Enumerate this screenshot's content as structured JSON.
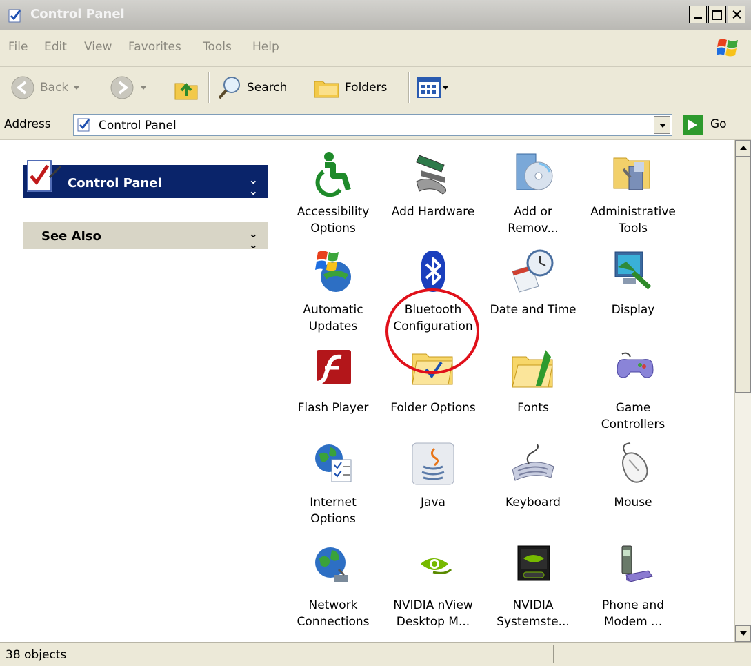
{
  "window": {
    "title": "Control Panel"
  },
  "menu": {
    "items": [
      "File",
      "Edit",
      "View",
      "Favorites",
      "Tools",
      "Help"
    ]
  },
  "toolbar": {
    "back_label": "Back",
    "search_label": "Search",
    "folders_label": "Folders"
  },
  "address": {
    "label": "Address",
    "value": "Control Panel",
    "go_label": "Go"
  },
  "taskpane": {
    "control_panel_label": "Control Panel",
    "see_also_label": "See Also"
  },
  "items": [
    {
      "label": "Accessibility\nOptions",
      "icon": "accessibility-icon"
    },
    {
      "label": "Add Hardware",
      "icon": "add-hardware-icon"
    },
    {
      "label": "Add or\nRemov...",
      "icon": "add-remove-programs-icon"
    },
    {
      "label": "Administrative\nTools",
      "icon": "administrative-tools-icon"
    },
    {
      "label": "Automatic\nUpdates",
      "icon": "automatic-updates-icon"
    },
    {
      "label": "Bluetooth\nConfiguration",
      "icon": "bluetooth-icon"
    },
    {
      "label": "Date and Time",
      "icon": "date-time-icon"
    },
    {
      "label": "Display",
      "icon": "display-icon"
    },
    {
      "label": "Flash Player",
      "icon": "flash-player-icon"
    },
    {
      "label": "Folder Options",
      "icon": "folder-options-icon"
    },
    {
      "label": "Fonts",
      "icon": "fonts-icon"
    },
    {
      "label": "Game\nControllers",
      "icon": "game-controller-icon"
    },
    {
      "label": "Internet\nOptions",
      "icon": "internet-options-icon"
    },
    {
      "label": "Java",
      "icon": "java-icon"
    },
    {
      "label": "Keyboard",
      "icon": "keyboard-icon"
    },
    {
      "label": "Mouse",
      "icon": "mouse-icon"
    },
    {
      "label": "Network\nConnections",
      "icon": "network-connections-icon"
    },
    {
      "label": "NVIDIA nView\nDesktop M...",
      "icon": "nvidia-nview-icon"
    },
    {
      "label": "NVIDIA\nSystemste...",
      "icon": "nvidia-systemsteuerung-icon"
    },
    {
      "label": "Phone and\nModem ...",
      "icon": "phone-modem-icon"
    }
  ],
  "status": {
    "text": "38 objects"
  },
  "colors": {
    "highlight_ring": "#e0101a",
    "taskpane_header": "#0a246a"
  }
}
